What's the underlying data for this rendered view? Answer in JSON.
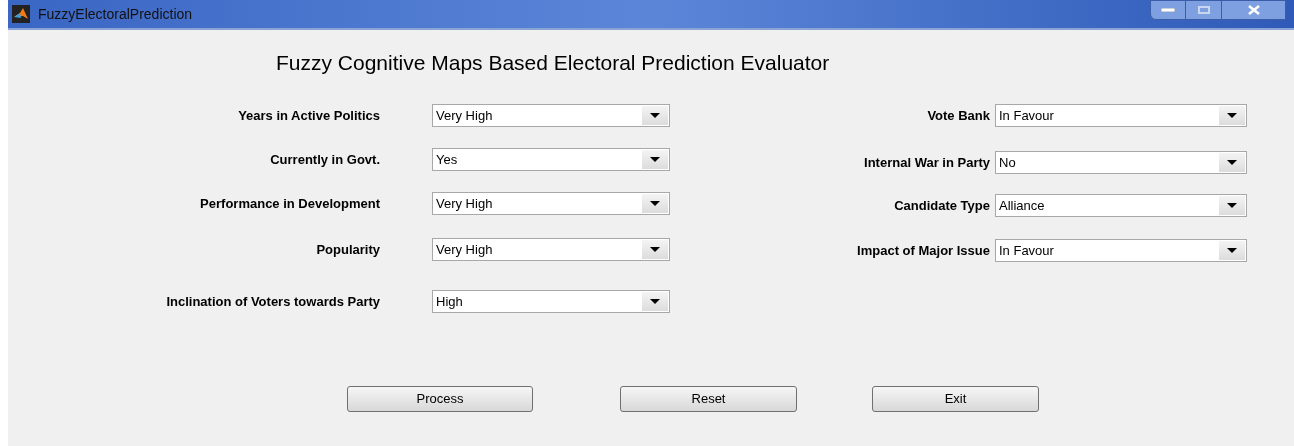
{
  "window": {
    "title": "FuzzyElectoralPrediction"
  },
  "heading": "Fuzzy Cognitive Maps Based Electoral Prediction Evaluator",
  "left_fields": [
    {
      "label": "Years in Active Politics",
      "value": "Very High"
    },
    {
      "label": "Currently in Govt.",
      "value": "Yes"
    },
    {
      "label": "Performance in Development",
      "value": "Very High"
    },
    {
      "label": "Popularity",
      "value": "Very High"
    },
    {
      "label": "Inclination of Voters towards Party",
      "value": "High"
    }
  ],
  "right_fields": [
    {
      "label": "Vote Bank",
      "value": "In Favour"
    },
    {
      "label": "Internal War in Party",
      "value": "No"
    },
    {
      "label": "Candidate Type",
      "value": "Alliance"
    },
    {
      "label": "Impact of Major Issue",
      "value": "In Favour"
    }
  ],
  "buttons": [
    "Process",
    "Reset",
    "Exit"
  ]
}
